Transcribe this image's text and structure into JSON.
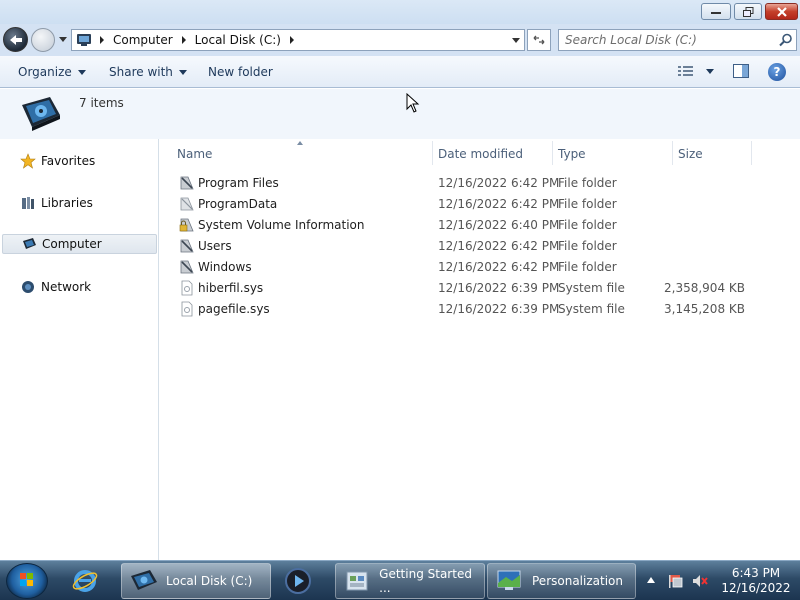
{
  "window": {
    "controls": {
      "minimize_icon": "minimize-icon",
      "maximize_icon": "restore-icon",
      "close_icon": "close-icon"
    }
  },
  "address": {
    "segments": [
      "Computer",
      "Local Disk (C:)"
    ],
    "search_placeholder": "Search Local Disk (C:)"
  },
  "toolbar": {
    "organize": "Organize",
    "share_with": "Share with",
    "new_folder": "New folder"
  },
  "info": {
    "item_count": "7 items"
  },
  "nav": {
    "favorites": "Favorites",
    "libraries": "Libraries",
    "computer": "Computer",
    "network": "Network"
  },
  "columns": {
    "name": "Name",
    "date": "Date modified",
    "type": "Type",
    "size": "Size"
  },
  "files": [
    {
      "name": "Program Files",
      "date": "12/16/2022 6:42 PM",
      "type": "File folder",
      "size": "",
      "icon": "folder-icon"
    },
    {
      "name": "ProgramData",
      "date": "12/16/2022 6:42 PM",
      "type": "File folder",
      "size": "",
      "icon": "folder-icon"
    },
    {
      "name": "System Volume Information",
      "date": "12/16/2022 6:40 PM",
      "type": "File folder",
      "size": "",
      "icon": "locked-folder-icon"
    },
    {
      "name": "Users",
      "date": "12/16/2022 6:42 PM",
      "type": "File folder",
      "size": "",
      "icon": "folder-icon"
    },
    {
      "name": "Windows",
      "date": "12/16/2022 6:42 PM",
      "type": "File folder",
      "size": "",
      "icon": "folder-icon"
    },
    {
      "name": "hiberfil.sys",
      "date": "12/16/2022 6:39 PM",
      "type": "System file",
      "size": "2,358,904 KB",
      "icon": "system-file-icon"
    },
    {
      "name": "pagefile.sys",
      "date": "12/16/2022 6:39 PM",
      "type": "System file",
      "size": "3,145,208 KB",
      "icon": "system-file-icon"
    }
  ],
  "taskbar": {
    "items": [
      {
        "label": "Local Disk (C:)"
      },
      {
        "label": "Getting Started ..."
      },
      {
        "label": "Personalization"
      }
    ],
    "clock_time": "6:43 PM",
    "clock_date": "12/16/2022"
  },
  "colors": {
    "accent": "#1e395b",
    "taskbar": "#2d4a66",
    "selection": "#dfe6ee"
  }
}
